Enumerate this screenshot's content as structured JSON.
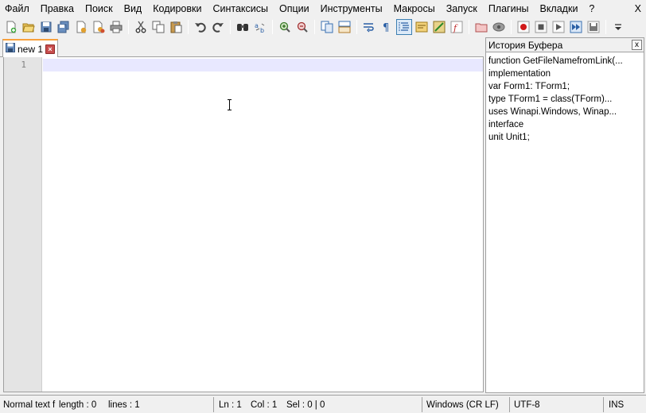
{
  "menu": {
    "items": [
      "Файл",
      "Правка",
      "Поиск",
      "Вид",
      "Кодировки",
      "Синтаксисы",
      "Опции",
      "Инструменты",
      "Макросы",
      "Запуск",
      "Плагины",
      "Вкладки",
      "?"
    ],
    "close_label": "X"
  },
  "toolbar": {
    "buttons": [
      "new-file-icon",
      "open-file-icon",
      "save-icon",
      "save-all-icon",
      "close-icon",
      "close-all-icon",
      "print-icon",
      "cut-icon",
      "copy-icon",
      "paste-icon",
      "undo-icon",
      "redo-icon",
      "find-icon",
      "replace-icon",
      "zoom-in-icon",
      "zoom-out-icon",
      "sync-vertical-icon",
      "sync-horizontal-icon",
      "word-wrap-icon",
      "show-all-chars-icon",
      "indent-guide-icon",
      "user-language-icon",
      "document-map-icon",
      "function-list-icon",
      "folder-workspace-icon",
      "monitoring-icon",
      "macro-record-icon",
      "macro-stop-icon",
      "macro-play-icon",
      "macro-run-multiple-icon",
      "macro-save-icon",
      "toolbar-overflow-icon"
    ],
    "active_button": "indent-guide-icon"
  },
  "tabs": [
    {
      "label": "new 1",
      "icon": "document-icon",
      "close": "close-tab-icon"
    }
  ],
  "editor": {
    "line_numbers": [
      "1"
    ],
    "content": ""
  },
  "clipboard_panel": {
    "title": "История Буфера",
    "close_label": "x",
    "items": [
      "function GetFileNamefromLink(...",
      "implementation",
      "var  Form1: TForm1;",
      "type  TForm1 = class(TForm)...",
      "uses  Winapi.Windows, Winap...",
      "interface",
      "unit Unit1;"
    ]
  },
  "statusbar": {
    "doc_type": "Normal text f",
    "length": "length : 0",
    "lines": "lines : 1",
    "ln": "Ln : 1",
    "col": "Col : 1",
    "sel": "Sel : 0 | 0",
    "eol": "Windows (CR LF)",
    "encoding": "UTF-8",
    "mode": "INS"
  },
  "colors": {
    "tab_accent": "#f8a13c",
    "current_line": "#e8e8ff",
    "gutter": "#e4e4e4",
    "active_button_border": "#3c7fb1"
  }
}
